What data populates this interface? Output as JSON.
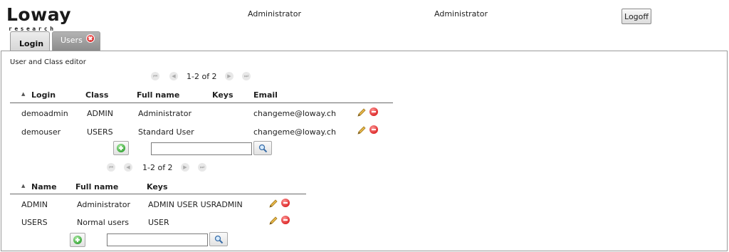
{
  "header": {
    "logo_text": "Loway",
    "logo_subtext": "research",
    "user_label_1": "Administrator",
    "user_label_2": "Administrator",
    "logoff_label": "Logoff"
  },
  "tabs": [
    {
      "label": "Login",
      "active": false
    },
    {
      "label": "Users",
      "active": true
    }
  ],
  "panel_title": "User and Class editor",
  "users_table": {
    "pager": {
      "text": "1-2 of 2"
    },
    "sort_indicator": "▲",
    "columns": [
      "Login",
      "Class",
      "Full name",
      "Keys",
      "Email"
    ],
    "rows": [
      {
        "login": "demoadmin",
        "class": "ADMIN",
        "full_name": "Administrator",
        "keys": "",
        "email": "changeme@loway.ch"
      },
      {
        "login": "demouser",
        "class": "USERS",
        "full_name": "Standard User",
        "keys": "",
        "email": "changeme@loway.ch"
      }
    ],
    "search": {
      "value": "",
      "placeholder": ""
    }
  },
  "classes_table": {
    "pager": {
      "text": "1-2 of 2"
    },
    "sort_indicator": "▲",
    "columns": [
      "Name",
      "Full name",
      "Keys"
    ],
    "rows": [
      {
        "name": "ADMIN",
        "full_name": "Administrator",
        "keys": "ADMIN USER USRADMIN"
      },
      {
        "name": "USERS",
        "full_name": "Normal users",
        "keys": "USER"
      }
    ],
    "search": {
      "value": "",
      "placeholder": ""
    }
  },
  "colors": {
    "delete": "#dd2a2a",
    "add": "#3aa83a",
    "edit": "#e0b040",
    "tab_active": "#9e9e9e"
  },
  "icons": {
    "first": "first-page-icon",
    "prev": "prev-page-icon",
    "next": "next-page-icon",
    "last": "last-page-icon",
    "edit": "pencil-icon",
    "delete": "delete-icon",
    "add": "add-icon",
    "search": "magnifier-icon",
    "close_tab": "close-icon"
  }
}
